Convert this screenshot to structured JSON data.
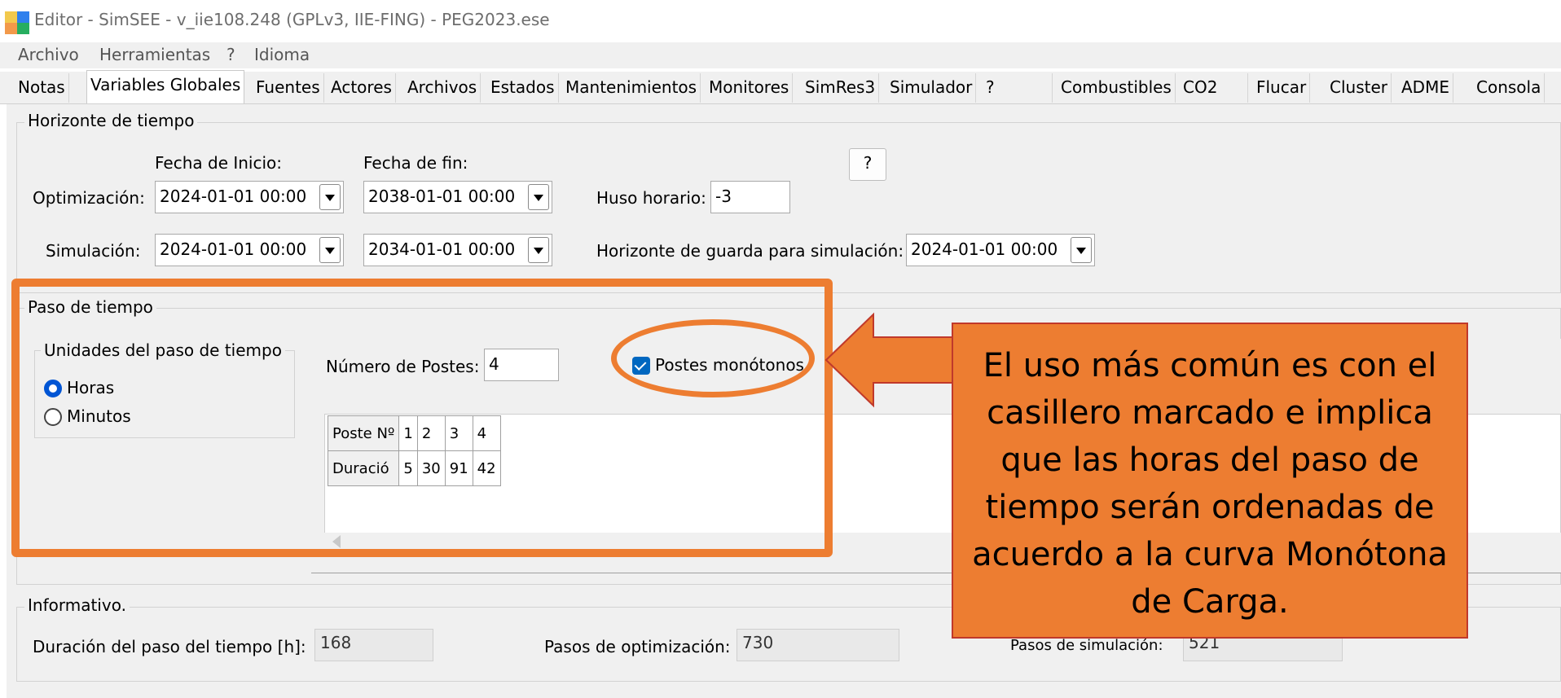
{
  "window": {
    "title": "Editor - SimSEE - v_iie108.248 (GPLv3, IIE-FING) - PEG2023.ese"
  },
  "menu": [
    "Archivo",
    "Herramientas",
    "?",
    "Idioma"
  ],
  "tabs": [
    "Notas",
    "Variables Globales",
    "Fuentes",
    "Actores",
    "Archivos",
    "Estados",
    "Mantenimientos",
    "Monitores",
    "SimRes3",
    "Simulador",
    "?",
    "Combustibles",
    "CO2",
    "Flucar",
    "Cluster",
    "ADME",
    "Consola"
  ],
  "active_tab": "Variables Globales",
  "horizonte": {
    "legend": "Horizonte de tiempo",
    "fecha_inicio_label": "Fecha de Inicio:",
    "fecha_fin_label": "Fecha de fin:",
    "help_label": "?",
    "optimizacion_label": "Optimización:",
    "opt_inicio": "2024-01-01   00:00",
    "opt_fin": "2038-01-01   00:00",
    "huso_label": "Huso horario:",
    "huso_value": "-3",
    "simulacion_label": "Simulación:",
    "sim_inicio": "2024-01-01   00:00",
    "sim_fin": "2034-01-01   00:00",
    "guarda_label": "Horizonte de guarda para simulación:",
    "guarda_value": "2024-01-01   00:00"
  },
  "paso": {
    "legend": "Paso de tiempo",
    "unidades_legend": "Unidades del paso de tiempo",
    "horas_label": "Horas",
    "minutos_label": "Minutos",
    "selected_unit": "Horas",
    "num_postes_label": "Número de Postes:",
    "num_postes_value": "4",
    "postes_monotonos_label": "Postes monótonos",
    "postes_monotonos_checked": true,
    "grid": {
      "row_headers": [
        "Poste Nº",
        "Duració"
      ],
      "columns": [
        "1",
        "2",
        "3",
        "4"
      ],
      "durations": [
        "5",
        "30",
        "91",
        "42"
      ]
    }
  },
  "informativo": {
    "legend": "Informativo.",
    "duracion_label": "Duración del paso del tiempo [h]:",
    "duracion_value": "168",
    "opt_pasos_label": "Pasos de optimización:",
    "opt_pasos_value": "730",
    "sim_pasos_label": "Pasos de simulación:",
    "sim_pasos_value": "521"
  },
  "annotation": {
    "callout_text": "El uso más común es con el casillero marcado e implica que las horas del paso de tiempo serán ordenadas de acuerdo a la curva Monótona de Carga.",
    "color": "#ed7d31"
  }
}
